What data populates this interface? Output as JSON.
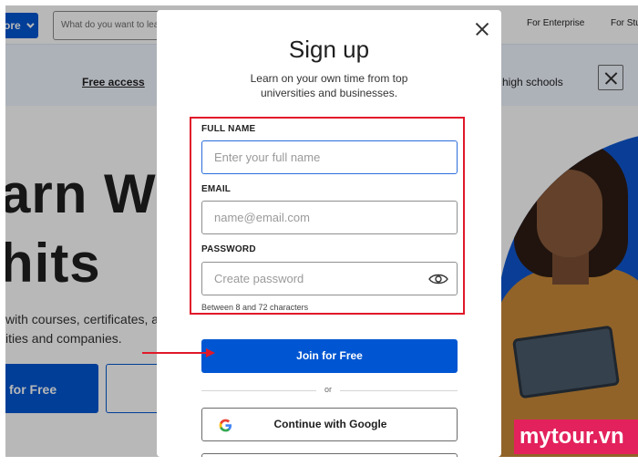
{
  "background": {
    "explore_label": "ore",
    "search_placeholder": "What do you want to lea",
    "nav": {
      "enterprise": "For Enterprise",
      "students": "For Stu"
    },
    "banner": {
      "free_access": "Free access",
      "tail": "high schools"
    },
    "hero": {
      "line1": "arn Wit",
      "line2": "hits",
      "sub1": "with courses, certificates, a",
      "sub2": "ities and companies.",
      "cta": "for Free"
    }
  },
  "modal": {
    "title": "Sign up",
    "subtitle": "Learn on your own time from top universities and businesses.",
    "fields": {
      "full_name": {
        "label": "FULL NAME",
        "placeholder": "Enter your full name",
        "value": ""
      },
      "email": {
        "label": "EMAIL",
        "placeholder": "name@email.com",
        "value": ""
      },
      "password": {
        "label": "PASSWORD",
        "placeholder": "Create password",
        "value": ""
      }
    },
    "password_hint": "Between 8 and 72 characters",
    "join_button": "Join for Free",
    "divider": "or",
    "google_button": "Continue with Google"
  },
  "watermark": "mytour.vn",
  "colors": {
    "brand_blue": "#0056d2",
    "annotation_red": "#e0182a",
    "focus_blue": "#2a6edb",
    "watermark_bg": "#e3215c"
  },
  "icons": [
    "chevron-down-icon",
    "close-icon",
    "eye-icon",
    "google-icon",
    "arrow-right-icon"
  ]
}
